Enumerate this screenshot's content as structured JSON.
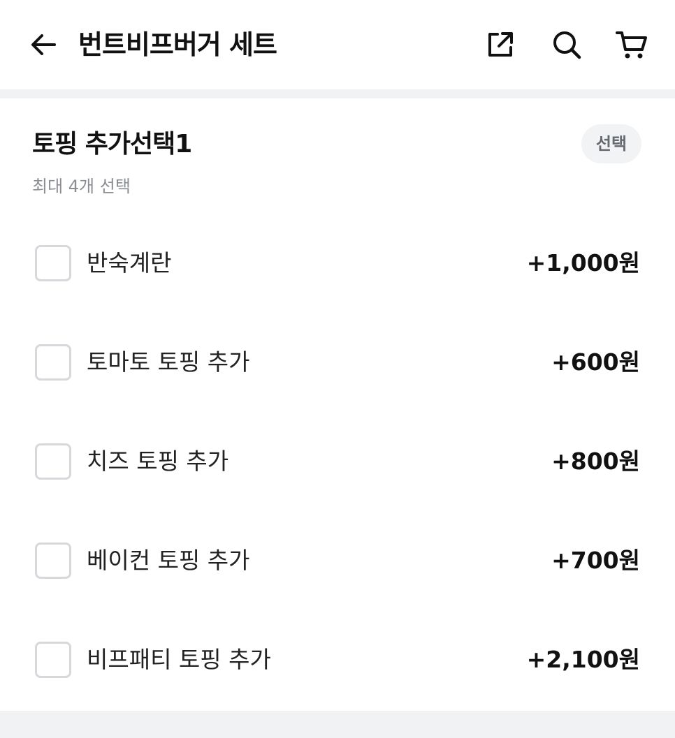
{
  "header": {
    "title": "번트비프버거 세트",
    "icons": {
      "back": "arrow-left-icon",
      "share": "share-external-icon",
      "search": "search-icon",
      "cart": "cart-icon"
    }
  },
  "section": {
    "title": "토핑 추가선택1",
    "badge": "선택",
    "subtitle": "최대 4개 선택",
    "options": [
      {
        "label": "반숙계란",
        "price": "+1,000원",
        "checked": false
      },
      {
        "label": "토마토 토핑 추가",
        "price": "+600원",
        "checked": false
      },
      {
        "label": "치즈 토핑 추가",
        "price": "+800원",
        "checked": false
      },
      {
        "label": "베이컨 토핑 추가",
        "price": "+700원",
        "checked": false
      },
      {
        "label": "비프패티 토핑 추가",
        "price": "+2,100원",
        "checked": false
      }
    ]
  },
  "colors": {
    "divider": "#f1f2f4",
    "checkbox_border": "#d6d8db",
    "badge_bg": "#f2f3f5",
    "subtitle": "#8a8d92"
  }
}
